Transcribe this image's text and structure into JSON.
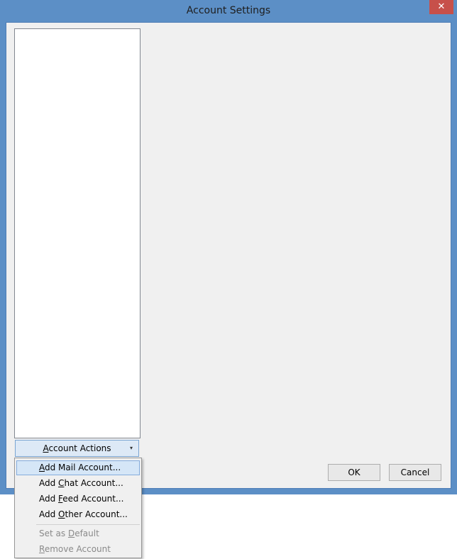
{
  "window": {
    "title": "Account Settings",
    "close_glyph": "✕"
  },
  "account_actions": {
    "label_pre": "",
    "label_key": "A",
    "label_post": "ccount Actions",
    "arrow": "▾"
  },
  "dialog_buttons": {
    "ok": "OK",
    "cancel": "Cancel"
  },
  "menu": {
    "items": [
      {
        "pre": "",
        "key": "A",
        "post": "dd Mail Account...",
        "enabled": true,
        "highlighted": true
      },
      {
        "pre": "Add ",
        "key": "C",
        "post": "hat Account...",
        "enabled": true,
        "highlighted": false
      },
      {
        "pre": "Add ",
        "key": "F",
        "post": "eed Account...",
        "enabled": true,
        "highlighted": false
      },
      {
        "pre": "Add ",
        "key": "O",
        "post": "ther Account...",
        "enabled": true,
        "highlighted": false
      },
      {
        "pre": "Set as ",
        "key": "D",
        "post": "efault",
        "enabled": false,
        "highlighted": false
      },
      {
        "pre": "",
        "key": "R",
        "post": "emove Account",
        "enabled": false,
        "highlighted": false
      }
    ]
  },
  "colors": {
    "frame": "#5c8fc6",
    "close": "#c7504a",
    "highlight": "#d5e6f7"
  }
}
